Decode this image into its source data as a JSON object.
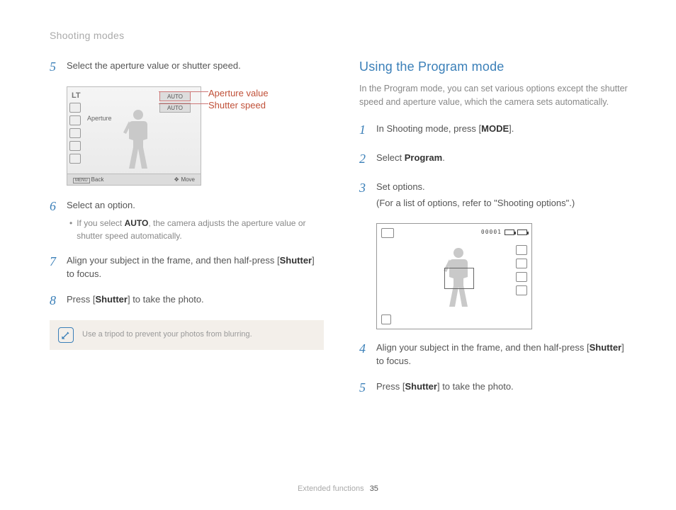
{
  "section_header": "Shooting modes",
  "left": {
    "step5": "Select the aperture value or shutter speed.",
    "diagram": {
      "badge": "LT",
      "auto1": "AUTO",
      "auto2": "AUTO",
      "aperture": "Aperture",
      "back": "Back",
      "move": "Move",
      "callout1": "Aperture value",
      "callout2": "Shutter speed",
      "menu": "MENU"
    },
    "step6": "Select an option.",
    "step6_bullet_pre": "If you select ",
    "step6_bullet_bold": "AUTO",
    "step6_bullet_post": ", the camera adjusts the aperture value or shutter speed automatically.",
    "step7_pre": "Align your subject in the frame, and then half-press [",
    "step7_bold": "Shutter",
    "step7_post": "] to focus.",
    "step8_pre": "Press [",
    "step8_bold": "Shutter",
    "step8_post": "] to take the photo.",
    "tip": "Use a tripod to prevent your photos from blurring."
  },
  "right": {
    "heading": "Using the Program mode",
    "intro": "In the Program mode, you can set various options except the shutter speed and aperture value, which the camera sets automatically.",
    "step1_pre": "In Shooting mode, press [",
    "step1_bold": "MODE",
    "step1_post": "].",
    "step2_pre": "Select ",
    "step2_bold": "Program",
    "step2_post": ".",
    "step3_a": "Set options.",
    "step3_b": "(For a list of options, refer to \"Shooting options\".)",
    "cam2_counter": "00001",
    "step4_pre": "Align your subject in the frame, and then half-press [",
    "step4_bold": "Shutter",
    "step4_post": "] to focus.",
    "step5_pre": "Press [",
    "step5_bold": "Shutter",
    "step5_post": "] to take the photo."
  },
  "footer": {
    "chapter": "Extended functions",
    "page": "35"
  }
}
